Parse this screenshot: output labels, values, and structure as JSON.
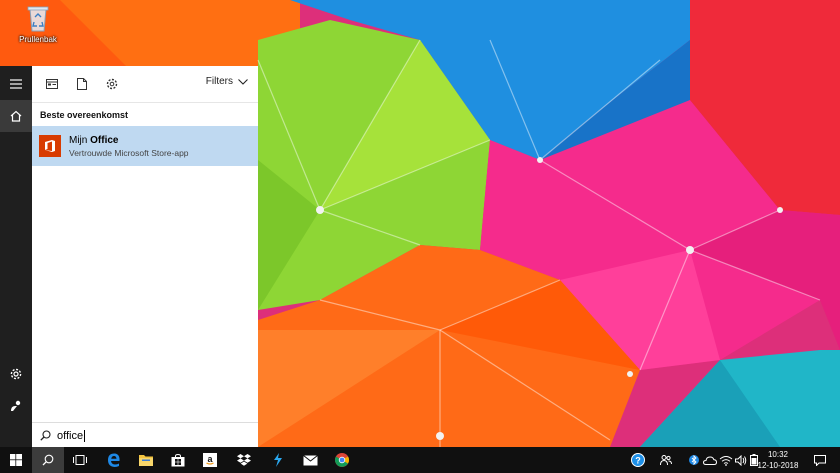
{
  "desktop": {
    "icon_label": "Prullenbak",
    "icon": "recycle-bin-icon"
  },
  "rail": {
    "items": [
      {
        "icon": "hamburger-menu-icon"
      },
      {
        "icon": "home-icon"
      },
      {
        "icon": "settings-gear-icon"
      },
      {
        "icon": "feedback-person-icon"
      }
    ]
  },
  "search_panel": {
    "toolbar_icons": [
      "apps-icon",
      "documents-icon",
      "settings-icon"
    ],
    "filters_label": "Filters",
    "section_title": "Beste overeenkomst",
    "best_match": {
      "title_prefix": "Mijn ",
      "title_match": "Office",
      "subtitle": "Vertrouwde Microsoft Store-app",
      "icon": "office-logo-icon"
    }
  },
  "search_box": {
    "value": "office",
    "icon": "search-icon"
  },
  "taskbar": {
    "apps": [
      "start-icon",
      "search-icon",
      "task-view-icon",
      "edge-icon",
      "file-explorer-icon",
      "store-icon",
      "amazon-icon",
      "dropbox-icon",
      "app-bolt-icon",
      "mail-icon",
      "chrome-icon"
    ],
    "tray": [
      "help-icon",
      "people-icon",
      "bluetooth-icon",
      "onedrive-icon",
      "wifi-icon",
      "volume-icon",
      "battery-icon"
    ],
    "time": "10:32",
    "date": "12-10-2018",
    "notification_icon": "action-center-icon"
  },
  "colors": {
    "taskbar": "#101010",
    "rail": "#1f1f1f",
    "result_highlight": "#bfd9f1",
    "office_red": "#d83b01",
    "edge_blue": "#1e88e5"
  }
}
